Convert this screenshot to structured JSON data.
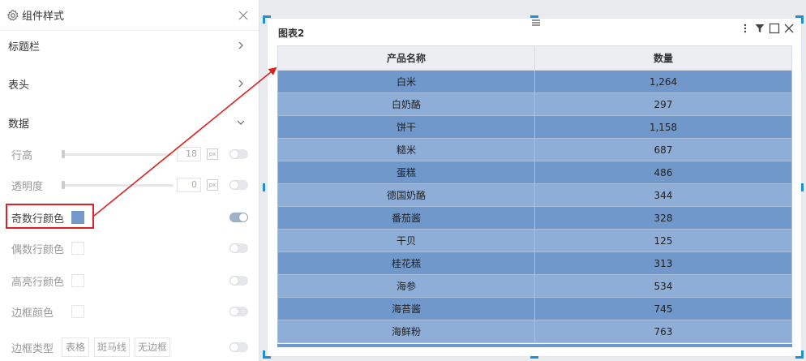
{
  "panel": {
    "title": "组件样式",
    "sections": [
      {
        "label": "标题栏"
      },
      {
        "label": "表头"
      },
      {
        "label": "数据"
      }
    ],
    "rows": {
      "row_height": {
        "label": "行高",
        "value": "18",
        "unit": "px"
      },
      "opacity": {
        "label": "透明度",
        "value": "0",
        "unit": "px"
      },
      "odd_row_color": {
        "label": "奇数行颜色",
        "color": "#7398c9"
      },
      "even_row_color": {
        "label": "偶数行颜色"
      },
      "highlight_row_color": {
        "label": "高亮行颜色"
      },
      "border_color": {
        "label": "边框颜色"
      },
      "border_type": {
        "label": "边框类型",
        "options": [
          "表格",
          "斑马线",
          "无边框"
        ]
      }
    }
  },
  "widget": {
    "title": "图表2",
    "columns": [
      "产品名称",
      "数量"
    ],
    "rows": [
      [
        "白米",
        "1,264"
      ],
      [
        "白奶酪",
        "297"
      ],
      [
        "饼干",
        "1,158"
      ],
      [
        "糙米",
        "687"
      ],
      [
        "蛋糕",
        "486"
      ],
      [
        "德国奶酪",
        "344"
      ],
      [
        "番茄酱",
        "328"
      ],
      [
        "干贝",
        "125"
      ],
      [
        "桂花糕",
        "313"
      ],
      [
        "海参",
        "534"
      ],
      [
        "海苔酱",
        "745"
      ],
      [
        "海鲜粉",
        "763"
      ]
    ]
  },
  "colors": {
    "odd_row": "#7098cb",
    "even_row": "#8eadd7",
    "selection": "#1e8fd8",
    "annotation": "#e02020"
  }
}
